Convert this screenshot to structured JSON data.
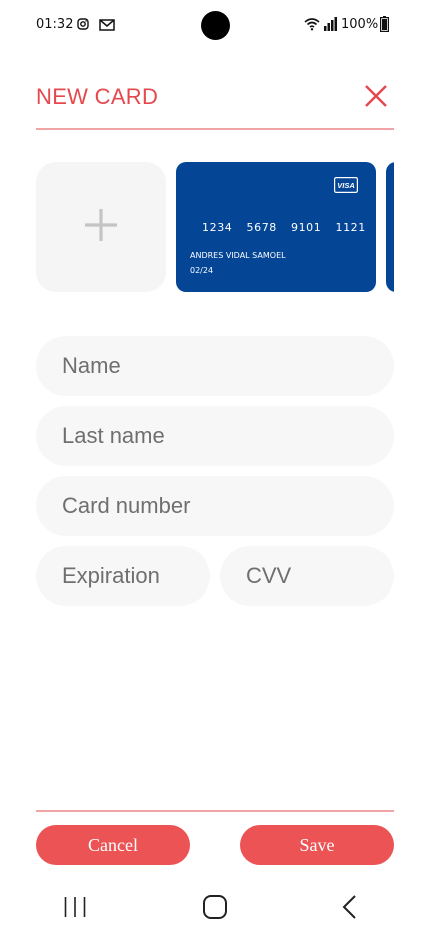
{
  "status_bar": {
    "time": "01:32",
    "battery": "100%",
    "icons": [
      "instagram-icon",
      "mail-icon",
      "wifi-icon",
      "signal-icon",
      "battery-icon"
    ]
  },
  "header": {
    "title": "NEW CARD",
    "close_icon": "close-icon"
  },
  "colors": {
    "accent": "#e5484d",
    "divider": "#f0a4a6",
    "button": "#eb5355",
    "card": "#044596",
    "field_bg": "#f7f7f7"
  },
  "cards": [
    {
      "brand": "VISA",
      "number": "1234 5678 9101 1121",
      "holder": "ANDRES VIDAL SAMOEL",
      "expiry": "02/24"
    }
  ],
  "form": {
    "name_placeholder": "Name",
    "last_name_placeholder": "Last name",
    "card_number_placeholder": "Card number",
    "expiration_placeholder": "Expiration",
    "cvv_placeholder": "CVV"
  },
  "footer": {
    "cancel_label": "Cancel",
    "save_label": "Save"
  }
}
